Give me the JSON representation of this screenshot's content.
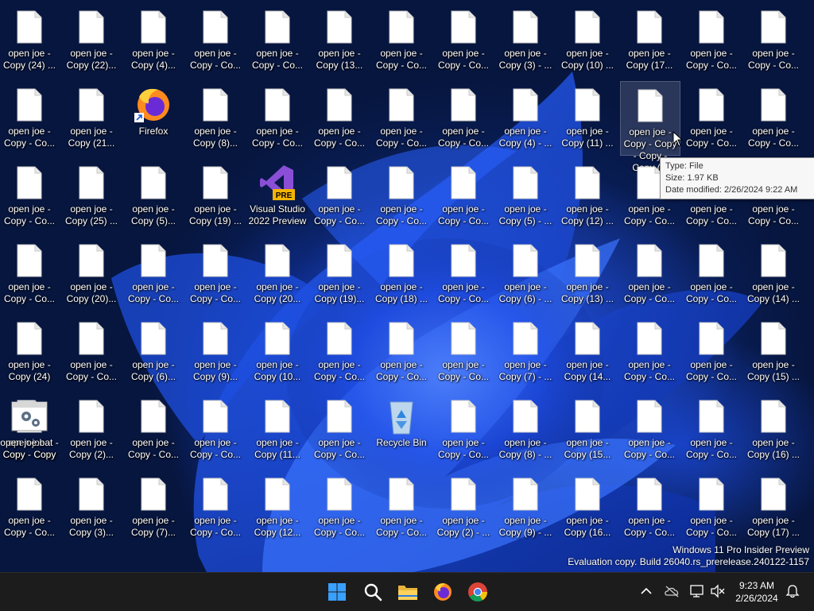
{
  "desktop": {
    "columns": [
      [
        "Copy (24) ...",
        "Copy - Co...",
        "Copy - Co...",
        "Copy - Co...",
        "Copy (24)",
        "Copy - Copy",
        "Copy - Co..."
      ],
      [
        "Copy (22)...",
        "Copy (21...",
        "Copy (25) ...",
        "Copy (20)...",
        "Copy - Co...",
        "Copy (2)...",
        "Copy (3)..."
      ],
      [
        "Copy (4)...",
        null,
        "Copy (5)...",
        "Copy - Co...",
        "Copy (6)...",
        "Copy - Co...",
        "Copy (7)..."
      ],
      [
        "Copy - Co...",
        "Copy (8)...",
        "Copy (19) ...",
        "Copy - Co...",
        "Copy (9)...",
        "Copy - Co...",
        "Copy - Co..."
      ],
      [
        "Copy - Co...",
        "Copy - Co...",
        null,
        "Copy (20...",
        "Copy (10...",
        "Copy (11...",
        "Copy (12..."
      ],
      [
        "Copy (13...",
        "Copy - Co...",
        "Copy - Co...",
        "Copy (19)...",
        "Copy - Co...",
        "Copy - Co...",
        "Copy - Co..."
      ],
      [
        "Copy - Co...",
        "Copy - Co...",
        "Copy - Co...",
        "Copy (18) ...",
        "Copy - Co...",
        null,
        "Copy - Co..."
      ],
      [
        "Copy - Co...",
        "Copy - Co...",
        "Copy - Co...",
        "Copy - Co...",
        "Copy - Co...",
        "Copy - Co...",
        "Copy (2) - ..."
      ],
      [
        "Copy (3) - ...",
        "Copy (4) - ...",
        "Copy (5) - ...",
        "Copy (6) - ...",
        "Copy (7) - ...",
        "Copy (8) - ...",
        "Copy (9) - ..."
      ],
      [
        "Copy (10) ...",
        "Copy (11) ...",
        "Copy (12) ...",
        "Copy (13) ...",
        "Copy (14...",
        "Copy (15...",
        "Copy (16..."
      ],
      [
        "Copy (17...",
        "Copy - Copy\n- Copy -\nCopy (...",
        "Copy - Co...",
        "Copy - Co...",
        "Copy - Co...",
        "Copy - Co...",
        "Copy - Co..."
      ],
      [
        "Copy - Co...",
        "Copy - Co...",
        "Copy - Co...",
        "Copy - Co...",
        "Copy - Co...",
        "Copy - Co...",
        "Copy - Co..."
      ],
      [
        "Copy - Co...",
        "Copy - Co...",
        "Copy - Co...",
        "Copy (14) ...",
        "Copy (15) ...",
        "Copy (16) ...",
        "Copy (17) ..."
      ]
    ],
    "label_prefix": "open joe -",
    "firefox_label": "Firefox",
    "vs_label": "Visual Studio\n2022 Preview",
    "vs_badge": "PRE",
    "recycle_label": "Recycle Bin",
    "bat_label": "open joe.bat -\nCopy - Copy",
    "top_left_label_overlap": "Terrijoe",
    "truncated_edge_letter": "e"
  },
  "tooltip": {
    "type": "Type: File",
    "size": "Size: 1.97 KB",
    "modified": "Date modified: 2/26/2024 9:22 AM"
  },
  "watermark": {
    "line1": "Windows 11 Pro Insider Preview",
    "line2": "Evaluation copy. Build 26040.rs_prerelease.240122-1157"
  },
  "taskbar": {
    "time": "9:23 AM",
    "date": "2/26/2024",
    "pinned": [
      "start-icon",
      "search-icon",
      "file-explorer-icon",
      "firefox-icon",
      "chrome-icon"
    ],
    "tray": [
      "chevron-up-icon",
      "onedrive-icon",
      "network-icon",
      "volume-muted-icon",
      "notification-bell-icon"
    ]
  },
  "colors": {
    "taskbar_bg": "#1c1c1c",
    "wallpaper_blue": "#1f5af0",
    "accent_start": "#3aa0ff"
  }
}
